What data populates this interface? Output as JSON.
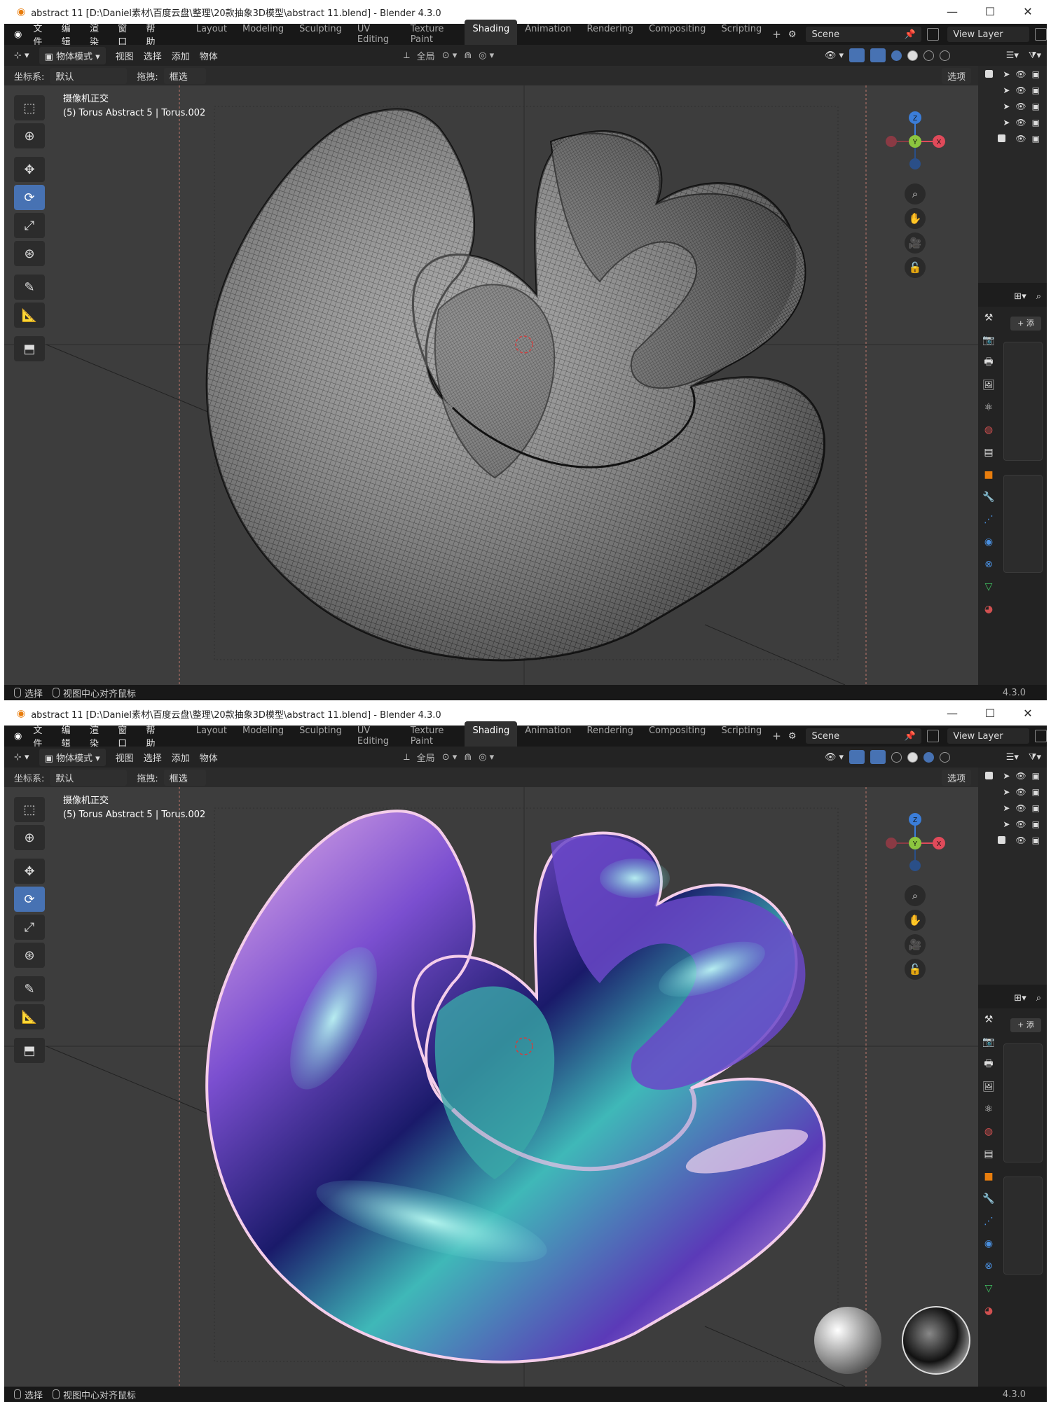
{
  "window": {
    "title": "abstract 11 [D:\\Daniel素材\\百度云盘\\整理\\20款抽象3D模型\\abstract 11.blend] - Blender 4.3.0",
    "min": "—",
    "max": "☐",
    "close": "✕"
  },
  "menu": [
    "文件",
    "编辑",
    "渲染",
    "窗口",
    "帮助"
  ],
  "workspaces": [
    "Layout",
    "Modeling",
    "Sculpting",
    "UV Editing",
    "Texture Paint",
    "Shading",
    "Animation",
    "Rendering",
    "Compositing",
    "Scripting"
  ],
  "active_workspace": "Shading",
  "scene": "Scene",
  "view_layer": "View Layer",
  "header": {
    "mode": "物体模式",
    "view": "视图",
    "select": "选择",
    "add": "添加",
    "object": "物体",
    "global": "全局"
  },
  "subheader": {
    "coord_label": "坐标系:",
    "coord_value": "默认",
    "drag_label": "拖拽:",
    "drag_value": "框选",
    "options": "选项"
  },
  "viewport_info": {
    "line1": "摄像机正交",
    "line2": "(5) Torus Abstract 5 | Torus.002"
  },
  "gizmo": {
    "x": "X",
    "y": "Y",
    "z": "Z"
  },
  "props_add": "+ 添",
  "statusbar": {
    "select": "选择",
    "center": "视图中心对齐鼠标",
    "version": "4.3.0"
  },
  "colors": {
    "accent": "#4772b3",
    "axis_x": "#e04a5a",
    "axis_y": "#8cc63f",
    "axis_z": "#3b7dd8",
    "blender_orange": "#e87d0d"
  },
  "panes": [
    {
      "shading": "wireframe"
    },
    {
      "shading": "material-preview"
    }
  ]
}
